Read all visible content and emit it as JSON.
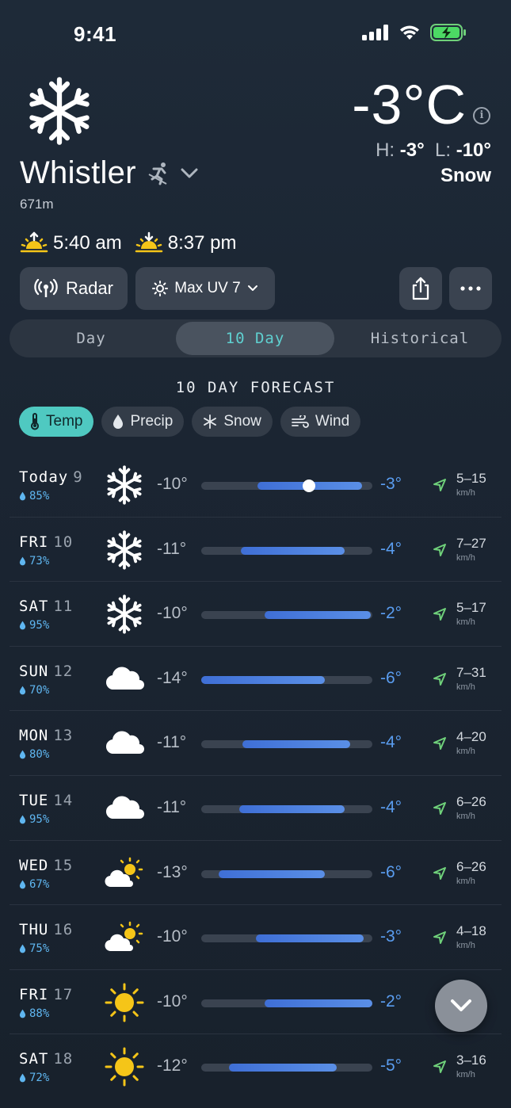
{
  "status": {
    "time": "9:41"
  },
  "location": {
    "name": "Whistler",
    "elevation": "671m"
  },
  "current": {
    "temp": "-3°C",
    "high_label": "H:",
    "high": "-3°",
    "low_label": "L:",
    "low": "-10°",
    "condition": "Snow",
    "info": "i"
  },
  "sun": {
    "sunrise": "5:40 am",
    "sunset": "8:37 pm"
  },
  "actions": {
    "radar": "Radar",
    "uv": "Max UV 7"
  },
  "tabs": [
    {
      "label": "Day"
    },
    {
      "label": "10 Day"
    },
    {
      "label": "Historical"
    }
  ],
  "section_title": "10 DAY FORECAST",
  "chips": [
    {
      "label": "Temp"
    },
    {
      "label": "Precip"
    },
    {
      "label": "Snow"
    },
    {
      "label": "Wind"
    }
  ],
  "forecast": [
    {
      "day": "Today",
      "date": "9",
      "precip": "85%",
      "icon": "snowflake-icon",
      "low": "-10°",
      "high": "-3°",
      "bar_start": 0.33,
      "bar_end": 0.94,
      "current_marker": 0.63,
      "wind": "5–15",
      "wind_unit": "km/h"
    },
    {
      "day": "FRI",
      "date": "10",
      "precip": "73%",
      "icon": "snowflake-icon",
      "low": "-11°",
      "high": "-4°",
      "bar_start": 0.23,
      "bar_end": 0.84,
      "wind": "7–27",
      "wind_unit": "km/h"
    },
    {
      "day": "SAT",
      "date": "11",
      "precip": "95%",
      "icon": "snowflake-icon",
      "low": "-10°",
      "high": "-2°",
      "bar_start": 0.37,
      "bar_end": 0.99,
      "wind": "5–17",
      "wind_unit": "km/h"
    },
    {
      "day": "SUN",
      "date": "12",
      "precip": "70%",
      "icon": "cloud-icon",
      "low": "-14°",
      "high": "-6°",
      "bar_start": 0.0,
      "bar_end": 0.72,
      "wind": "7–31",
      "wind_unit": "km/h"
    },
    {
      "day": "MON",
      "date": "13",
      "precip": "80%",
      "icon": "cloud-icon",
      "low": "-11°",
      "high": "-4°",
      "bar_start": 0.24,
      "bar_end": 0.87,
      "wind": "4–20",
      "wind_unit": "km/h"
    },
    {
      "day": "TUE",
      "date": "14",
      "precip": "95%",
      "icon": "cloud-icon",
      "low": "-11°",
      "high": "-4°",
      "bar_start": 0.22,
      "bar_end": 0.84,
      "wind": "6–26",
      "wind_unit": "km/h"
    },
    {
      "day": "WED",
      "date": "15",
      "precip": "67%",
      "icon": "partly-sunny-icon",
      "low": "-13°",
      "high": "-6°",
      "bar_start": 0.1,
      "bar_end": 0.72,
      "wind": "6–26",
      "wind_unit": "km/h"
    },
    {
      "day": "THU",
      "date": "16",
      "precip": "75%",
      "icon": "partly-sunny-icon",
      "low": "-10°",
      "high": "-3°",
      "bar_start": 0.32,
      "bar_end": 0.95,
      "wind": "4–18",
      "wind_unit": "km/h"
    },
    {
      "day": "FRI",
      "date": "17",
      "precip": "88%",
      "icon": "sun-icon",
      "low": "-10°",
      "high": "-2°",
      "bar_start": 0.37,
      "bar_end": 1.0,
      "wind": "",
      "wind_unit": ""
    },
    {
      "day": "SAT",
      "date": "18",
      "precip": "72%",
      "icon": "sun-icon",
      "low": "-12°",
      "high": "-5°",
      "bar_start": 0.16,
      "bar_end": 0.79,
      "wind": "3–16",
      "wind_unit": "km/h"
    }
  ],
  "colors": {
    "accent": "#4fc9c1",
    "bar": "#4a7fe0",
    "high": "#5a9df0",
    "precip": "#5fb6f0",
    "wind_arrow": "#6fd07a",
    "sun": "#f5c518"
  }
}
